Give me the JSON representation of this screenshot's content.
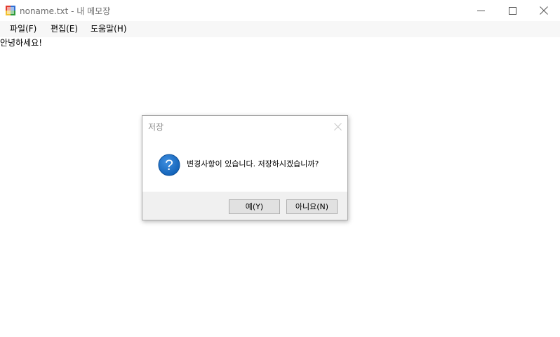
{
  "window": {
    "title": "noname.txt - 내 메모장",
    "controls": {
      "minimize": "minimize-icon",
      "maximize": "maximize-icon",
      "close": "close-icon"
    }
  },
  "menu": {
    "file": "파일(F)",
    "edit": "편집(E)",
    "help": "도움말(H)"
  },
  "editor": {
    "text": "안녕하세요!"
  },
  "dialog": {
    "title": "저장",
    "icon": "question-icon",
    "message": "변경사항이 있습니다. 저장하시겠습니까?",
    "yes_label": "예(Y)",
    "no_label": "아니요(N)"
  },
  "colors": {
    "menubar_bg": "#f7f7f7",
    "dialog_footer_bg": "#f0f0f0",
    "question_icon_blue": "#1a6cc4",
    "button_face": "#e1e1e1"
  }
}
